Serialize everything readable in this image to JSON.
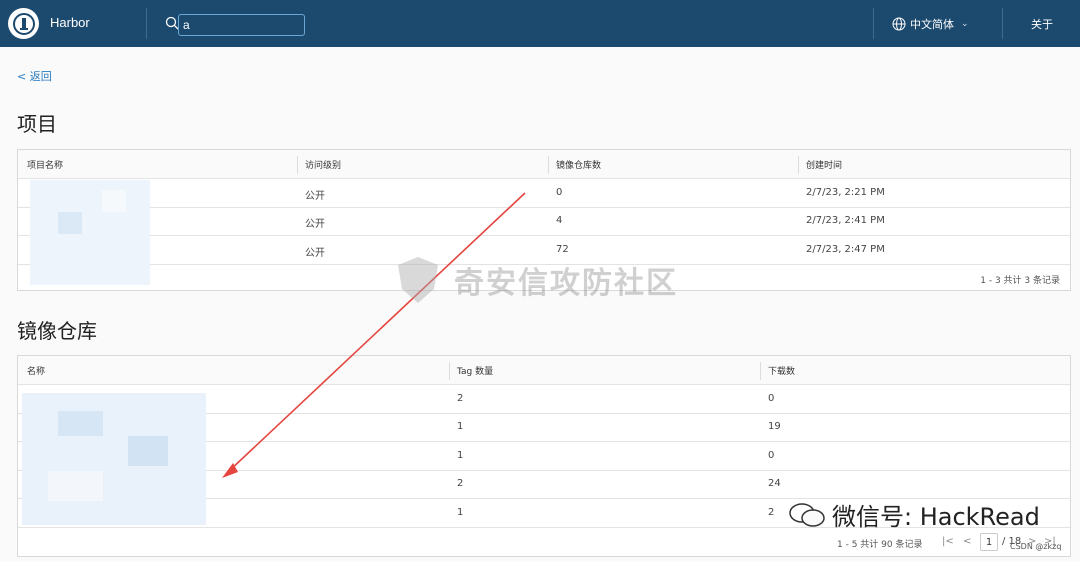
{
  "header": {
    "brand": "Harbor",
    "search_value": "a",
    "language": "中文简体",
    "about": "关于",
    "colors": {
      "nav_bg": "#1c4a6e",
      "link": "#2a7bbd"
    }
  },
  "back_link": "< 返回",
  "projects": {
    "title": "项目",
    "columns": [
      "项目名称",
      "访问级别",
      "镜像仓库数",
      "创建时间"
    ],
    "rows": [
      {
        "access": "公开",
        "repos": "0",
        "created": "2/7/23, 2:21 PM"
      },
      {
        "access": "公开",
        "repos": "4",
        "created": "2/7/23, 2:41 PM"
      },
      {
        "access": "公开",
        "repos": "72",
        "created": "2/7/23, 2:47 PM"
      }
    ],
    "footer": "1 - 3 共计 3 条记录"
  },
  "repositories": {
    "title": "镜像仓库",
    "columns": [
      "名称",
      "Tag 数量",
      "下载数"
    ],
    "rows": [
      {
        "tags": "2",
        "downloads": "0"
      },
      {
        "tags": "1",
        "downloads": "19"
      },
      {
        "tags": "1",
        "downloads": "0"
      },
      {
        "tags": "2",
        "downloads": "24"
      },
      {
        "tags": "1",
        "downloads": "2"
      }
    ],
    "footer": "1 - 5 共计 90 条记录",
    "pager": {
      "first": "|<",
      "prev": "<",
      "current_page": "1",
      "of_pages": "/ 18",
      "next": ">",
      "last": ">|"
    }
  },
  "watermark": "奇安信攻防社区",
  "wechat_mark": "微信号: HackRead",
  "csdn_mark": "CSDN @zkzq"
}
